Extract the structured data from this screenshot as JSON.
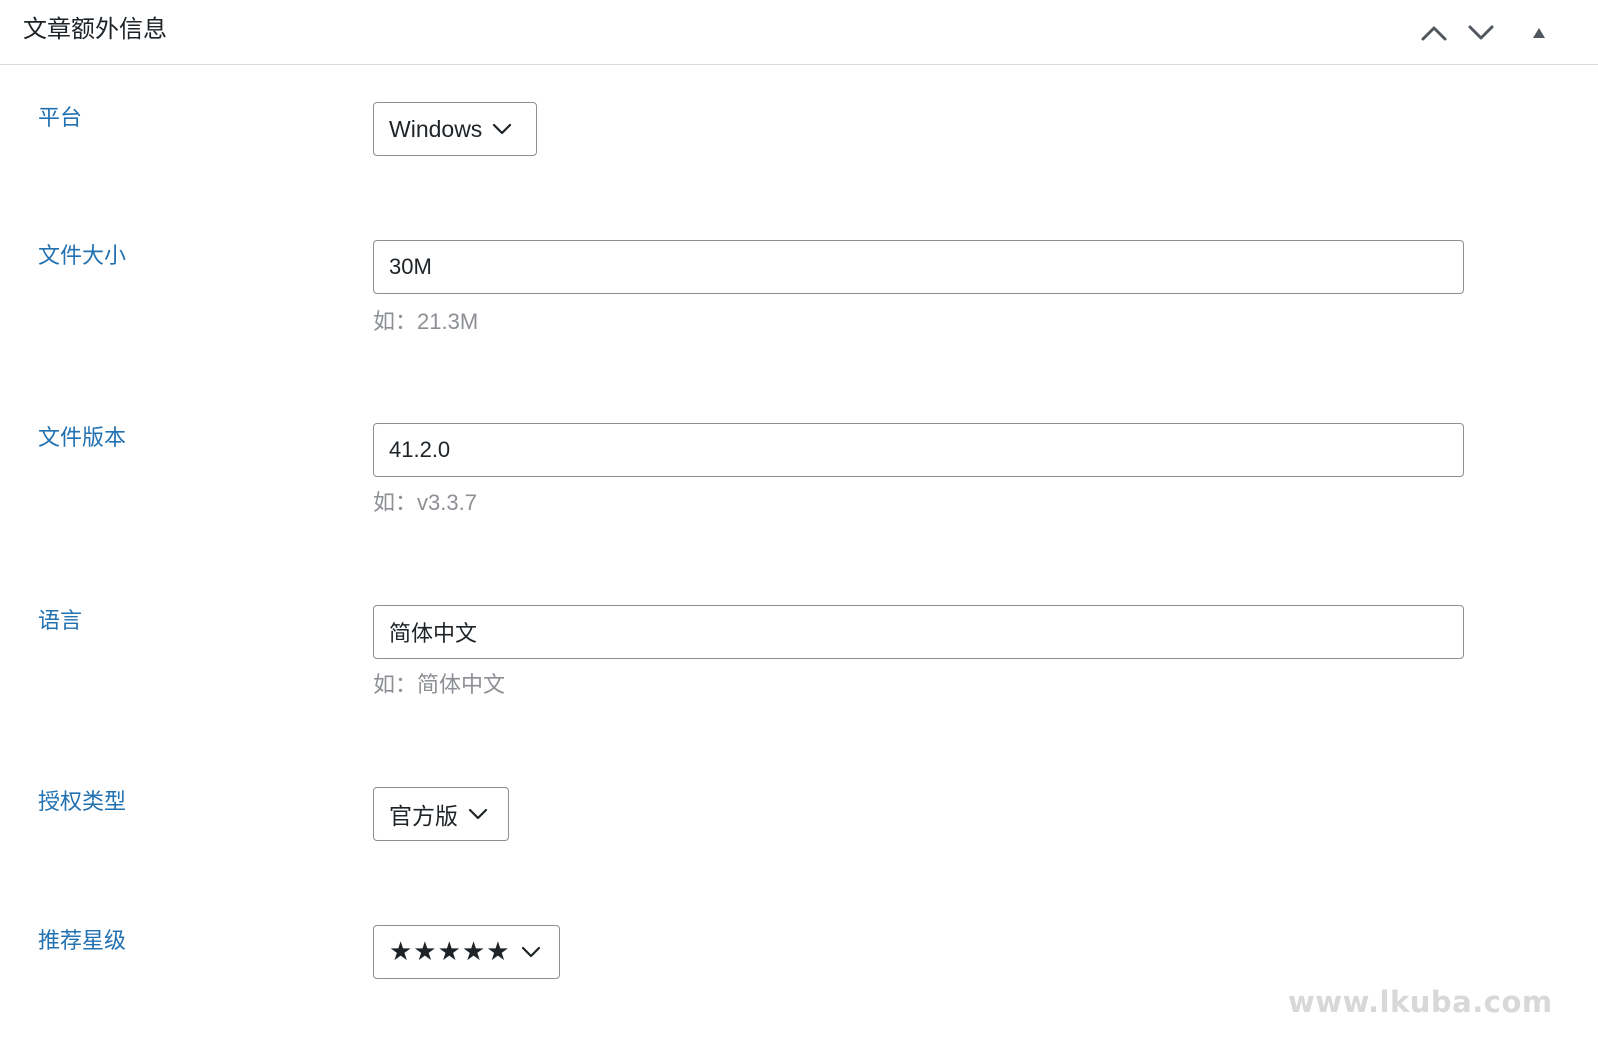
{
  "panel": {
    "title": "文章额外信息",
    "controls": [
      {
        "name": "move-up-button",
        "icon": "chevron-up-icon"
      },
      {
        "name": "move-down-button",
        "icon": "chevron-down-icon"
      },
      {
        "name": "toggle-panel-button",
        "icon": "triangle-up-icon"
      }
    ]
  },
  "fields": {
    "platform": {
      "label": "平台",
      "value": "Windows"
    },
    "file_size": {
      "label": "文件大小",
      "value": "30M",
      "hint": "如：21.3M"
    },
    "file_version": {
      "label": "文件版本",
      "value": "41.2.0",
      "hint": "如：v3.3.7"
    },
    "language": {
      "label": "语言",
      "value": "简体中文",
      "hint": "如：简体中文"
    },
    "license_type": {
      "label": "授权类型",
      "value": "官方版"
    },
    "rating": {
      "label": "推荐星级",
      "value": "★★★★★"
    }
  },
  "watermark": "www.lkuba.com",
  "colors": {
    "label": "#2271b1",
    "hint": "#8c8f94",
    "border": "#8c8f94",
    "text": "#1d2327"
  }
}
